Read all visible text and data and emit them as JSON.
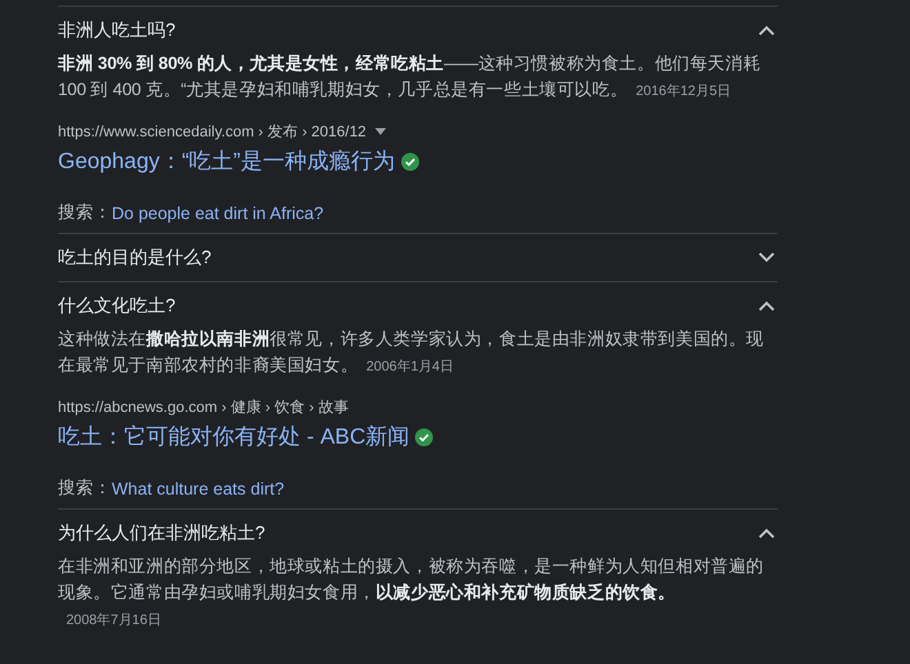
{
  "questions": [
    {
      "question": "非洲人吃土吗?",
      "expanded": true,
      "answer": "**非洲 30% 到 80% 的人，尤其是女性，经常吃粘土**——这种习惯被称为食土。他们每天消耗 100 到 400 克。“尤其是孕妇和哺乳期妇女，几乎总是有一些土壤可以吃。",
      "date": "2016年12月5日",
      "source": {
        "breadcrumb": "https://www.sciencedaily.com › 发布 › 2016/12",
        "has_menu": true,
        "title": "Geophagy：“吃土”是一种成瘾行为",
        "verified": true
      },
      "search_label": "搜索：",
      "search_query": "Do people eat dirt in Africa?"
    },
    {
      "question": "吃土的目的是什么?",
      "expanded": false
    },
    {
      "question": "什么文化吃土?",
      "expanded": true,
      "answer": "这种做法在**撒哈拉以南非洲**很常见，许多人类学家认为，食土是由非洲奴隶带到美国的。现在最常见于南部农村的非裔美国妇女。",
      "date": "2006年1月4日",
      "source": {
        "breadcrumb": "https://abcnews.go.com › 健康 › 饮食 › 故事",
        "has_menu": false,
        "title": "吃土：它可能对你有好处 - ABC新闻",
        "verified": true
      },
      "search_label": "搜索：",
      "search_query": "What culture eats dirt?"
    },
    {
      "question": "为什么人们在非洲吃粘土?",
      "expanded": true,
      "answer": "在非洲和亚洲的部分地区，地球或粘土的摄入，被称为吞噬，是一种鲜为人知但相对普遍的现象。它通常由孕妇或哺乳期妇女食用，**以减少恶心和补充矿物质缺乏的饮食。**",
      "date": "2008年7月16日"
    }
  ]
}
